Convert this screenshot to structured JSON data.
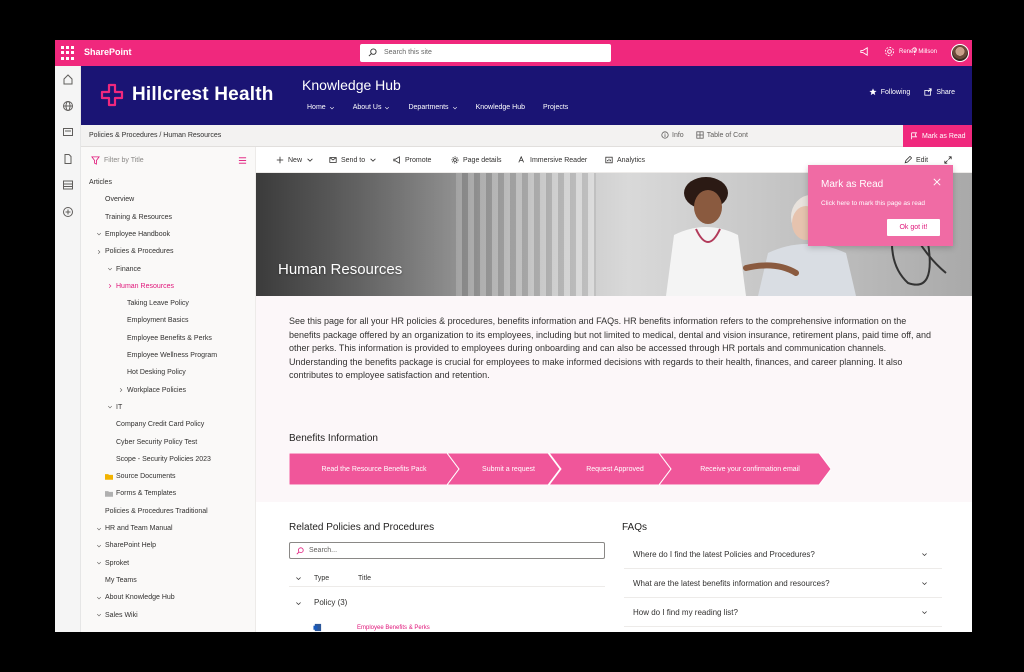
{
  "suite": {
    "app_name": "SharePoint",
    "search_placeholder": "Search this site",
    "user_name": "Renee Millson"
  },
  "site": {
    "logo_text": "Hillcrest Health",
    "hub_title": "Knowledge Hub",
    "nav": [
      {
        "label": "Home",
        "has_menu": true
      },
      {
        "label": "About Us",
        "has_menu": true
      },
      {
        "label": "Departments",
        "has_menu": true
      },
      {
        "label": "Knowledge Hub",
        "has_menu": false
      },
      {
        "label": "Projects",
        "has_menu": false
      }
    ],
    "following_label": "Following",
    "share_label": "Share"
  },
  "breadcrumb": {
    "text": "Policies & Procedures / Human Resources",
    "info_label": "Info",
    "toc_label": "Table of Cont",
    "mark_read_label": "Mark as Read"
  },
  "leftnav": {
    "filter_placeholder": "Filter by Title",
    "items": [
      {
        "label": "Articles",
        "level": 0,
        "chevron": "",
        "active": false
      },
      {
        "label": "Overview",
        "level": 1,
        "chevron": "",
        "active": false
      },
      {
        "label": "Training & Resources",
        "level": 1,
        "chevron": "",
        "active": false
      },
      {
        "label": "Employee Handbook",
        "level": 1,
        "chevron": "down",
        "active": false
      },
      {
        "label": "Policies & Procedures",
        "level": 1,
        "chevron": "right",
        "active": false
      },
      {
        "label": "Finance",
        "level": 2,
        "chevron": "down",
        "active": false
      },
      {
        "label": "Human Resources",
        "level": 2,
        "chevron": "right",
        "active": true
      },
      {
        "label": "Taking Leave Policy",
        "level": 3,
        "chevron": "",
        "active": false
      },
      {
        "label": "Employment Basics",
        "level": 3,
        "chevron": "",
        "active": false
      },
      {
        "label": "Employee Benefits & Perks",
        "level": 3,
        "chevron": "",
        "active": false
      },
      {
        "label": "Employee Wellness Program",
        "level": 3,
        "chevron": "",
        "active": false
      },
      {
        "label": "Hot Desking Policy",
        "level": 3,
        "chevron": "",
        "active": false
      },
      {
        "label": "Workplace Policies",
        "level": 3,
        "chevron": "right",
        "active": false
      },
      {
        "label": "IT",
        "level": 2,
        "chevron": "down",
        "active": false
      },
      {
        "label": "Company Credit Card Policy",
        "level": 2,
        "chevron": "",
        "active": false
      },
      {
        "label": "Cyber Security Policy Test",
        "level": 2,
        "chevron": "",
        "active": false
      },
      {
        "label": "Scope - Security Policies 2023",
        "level": 2,
        "chevron": "",
        "active": false
      },
      {
        "label": "Source Documents",
        "level": 2,
        "chevron": "",
        "active": false,
        "folder": "#f2b300"
      },
      {
        "label": "Forms & Templates",
        "level": 2,
        "chevron": "",
        "active": false,
        "folder": "#b0b0b0"
      },
      {
        "label": "Policies & Procedures Traditional",
        "level": 1,
        "chevron": "",
        "active": false
      },
      {
        "label": "HR and Team Manual",
        "level": 1,
        "chevron": "down",
        "active": false
      },
      {
        "label": "SharePoint Help",
        "level": 1,
        "chevron": "down",
        "active": false
      },
      {
        "label": "Sproket",
        "level": 1,
        "chevron": "down",
        "active": false
      },
      {
        "label": "My Teams",
        "level": 1,
        "chevron": "",
        "active": false
      },
      {
        "label": "About Knowledge Hub",
        "level": 1,
        "chevron": "down",
        "active": false
      },
      {
        "label": "Sales Wiki",
        "level": 1,
        "chevron": "down",
        "active": false
      }
    ]
  },
  "commands": {
    "new": "New",
    "send_to": "Send to",
    "promote": "Promote",
    "page_details": "Page details",
    "immersive_reader": "Immersive Reader",
    "analytics": "Analytics",
    "edit": "Edit"
  },
  "hero": {
    "title": "Human Resources"
  },
  "intro": {
    "text": "See this page for all your HR policies & procedures, benefits information and FAQs. HR benefits information refers to the comprehensive information on the benefits package offered by an organization to its employees, including but not limited to medical, dental and vision insurance, retirement plans, paid time off, and other perks. This information is provided to employees during onboarding and can also be accessed through HR portals and communication channels. Understanding the benefits package is crucial for employees to make informed decisions with regards to their health, finances, and career planning. It also contributes to employee satisfaction and retention."
  },
  "benefits": {
    "title": "Benefits Information",
    "steps": [
      "Read the Resource Benefits Pack",
      "Submit a request",
      "Request Approved",
      "Receive your confirmation email"
    ]
  },
  "related": {
    "title": "Related Policies and Procedures",
    "search_placeholder": "Search...",
    "col_type": "Type",
    "col_title": "Title",
    "group": "Policy (3)",
    "first_item": "Employee Benefits & Perks"
  },
  "faqs": {
    "title": "FAQs",
    "items": [
      "Where do I find the latest Policies and Procedures?",
      "What are the latest benefits information and resources?",
      "How do I find my reading list?"
    ]
  },
  "popup": {
    "title": "Mark as Read",
    "text": "Click here to mark this page as read",
    "button": "Ok got it!"
  },
  "colors": {
    "accent": "#f0287d",
    "header": "#1a1474",
    "popup": "#f06ba4",
    "active_link": "#e0167a",
    "step_fill": "#f0569a"
  },
  "icons": [
    "waffle-icon",
    "search-icon",
    "megaphone-icon",
    "gear-icon",
    "help-icon",
    "star-icon",
    "share-icon",
    "info-icon",
    "flag-icon",
    "filter-icon",
    "close-icon",
    "chevron-down-icon"
  ]
}
